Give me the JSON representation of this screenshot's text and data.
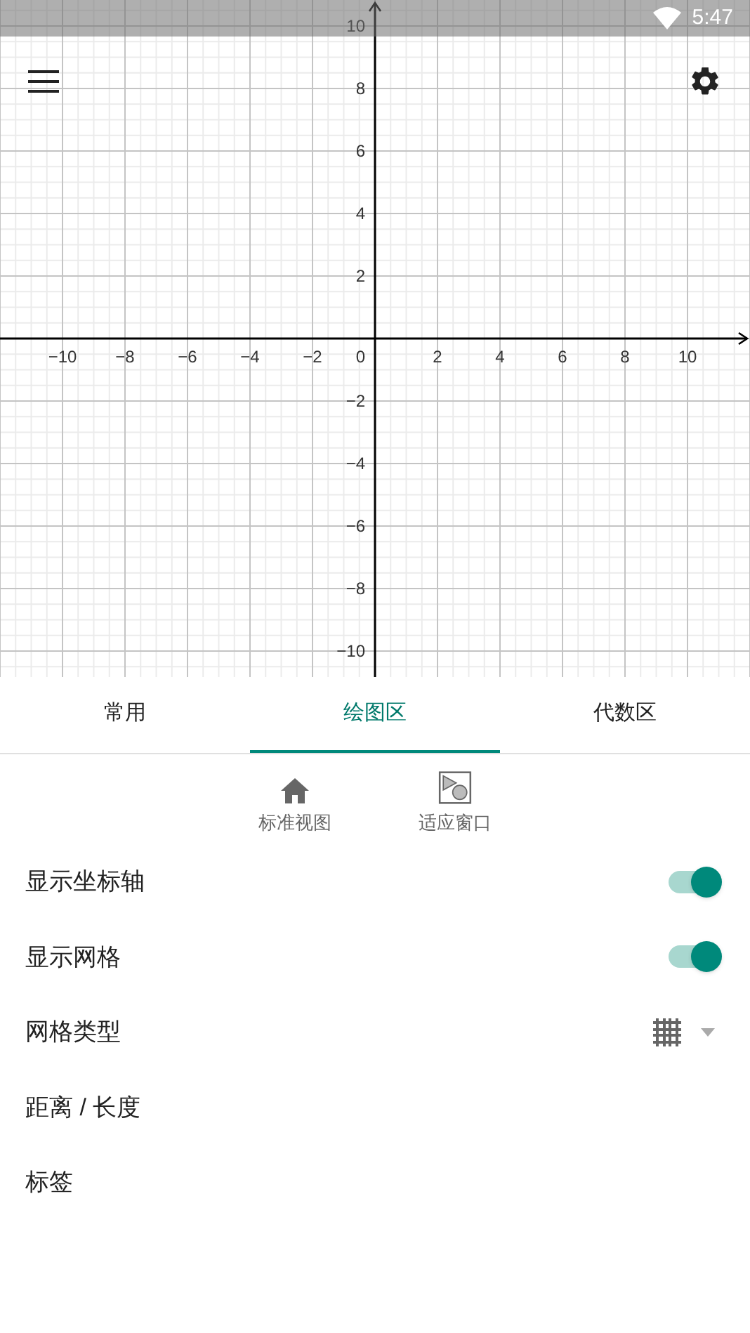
{
  "status_bar": {
    "time": "5:47"
  },
  "graph": {
    "x_labels": [
      "−10",
      "−8",
      "−6",
      "−4",
      "−2",
      "2",
      "4",
      "6",
      "8",
      "10"
    ],
    "y_labels": [
      "10",
      "8",
      "6",
      "4",
      "2",
      "−2",
      "−4",
      "−6",
      "−8",
      "−10"
    ],
    "origin_label": "0"
  },
  "tabs": [
    {
      "label": "常用",
      "selected": false
    },
    {
      "label": "绘图区",
      "selected": true
    },
    {
      "label": "代数区",
      "selected": false
    }
  ],
  "tools": [
    {
      "kind": "home",
      "label": "标准视图"
    },
    {
      "kind": "fit",
      "label": "适应窗口"
    }
  ],
  "settings": [
    {
      "kind": "toggle",
      "label": "显示坐标轴",
      "on": true
    },
    {
      "kind": "toggle",
      "label": "显示网格",
      "on": true
    },
    {
      "kind": "dropdown",
      "label": "网格类型"
    },
    {
      "kind": "plain",
      "label": "距离 / 长度"
    },
    {
      "kind": "plain",
      "label": "标签"
    }
  ]
}
